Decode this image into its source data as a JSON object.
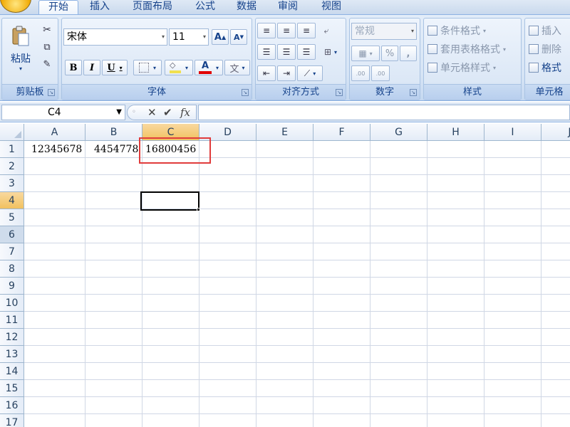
{
  "tabs": [
    {
      "label": "开始",
      "active": true
    },
    {
      "label": "插入",
      "active": false
    },
    {
      "label": "页面布局",
      "active": false
    },
    {
      "label": "公式",
      "active": false
    },
    {
      "label": "数据",
      "active": false
    },
    {
      "label": "审阅",
      "active": false
    },
    {
      "label": "视图",
      "active": false
    }
  ],
  "ribbon": {
    "clipboard": {
      "paste_label": "粘贴",
      "group_label": "剪贴板"
    },
    "font": {
      "font_name": "宋体",
      "font_size": "11",
      "bold": "B",
      "italic": "I",
      "underline": "U",
      "grow": "A",
      "shrink": "A",
      "font_color_glyph": "A",
      "wen_glyph": "文",
      "group_label": "字体"
    },
    "alignment": {
      "group_label": "对齐方式"
    },
    "number": {
      "format": "常规",
      "percent": "%",
      "comma": ",",
      "inc_decimal": ".00",
      "dec_decimal": ".00",
      "group_label": "数字"
    },
    "styles": {
      "conditional": "条件格式",
      "table_format": "套用表格格式",
      "cell_styles": "单元格样式",
      "group_label": "样式"
    },
    "cells": {
      "insert": "插入",
      "delete": "删除",
      "format": "格式",
      "group_label": "单元格"
    }
  },
  "formula_bar": {
    "name_box": "C4",
    "formula": "",
    "fx": "fx"
  },
  "grid": {
    "columns": [
      "A",
      "B",
      "C",
      "D",
      "E",
      "F",
      "G",
      "H",
      "I",
      "J"
    ],
    "rows": [
      "1",
      "2",
      "3",
      "4",
      "5",
      "6",
      "7",
      "8",
      "9",
      "10",
      "11",
      "12",
      "13",
      "14",
      "15",
      "16",
      "17"
    ],
    "selected_column": "C",
    "selected_row": "4",
    "cells": {
      "A1": "12345678",
      "B1": "4454778",
      "C1": "16800456"
    }
  },
  "colors": {
    "accent": "#15428b",
    "highlight_box": "#e03c3c",
    "selection_header": "#f1c15f"
  }
}
